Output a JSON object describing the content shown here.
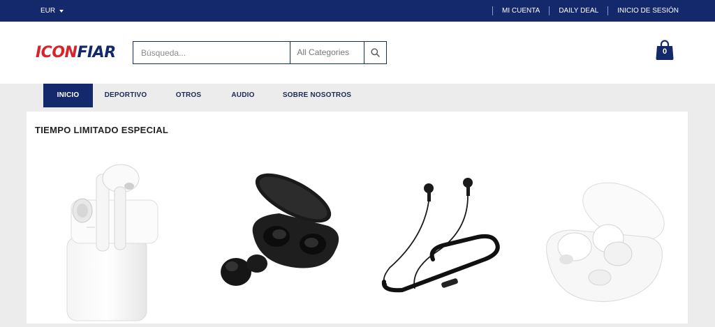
{
  "topbar": {
    "currency": "EUR",
    "links": [
      "MI CUENTA",
      "DAILY DEAL",
      "INICIO DE SESIÓN"
    ]
  },
  "header": {
    "logo_part1": "ICON",
    "logo_part2": "FIAR",
    "search_placeholder": "Búsqueda...",
    "category_selected": "All Categories",
    "cart_count": "0"
  },
  "nav": {
    "items": [
      "INICIO",
      "DEPORTIVO",
      "OTROS",
      "AUDIO",
      "SOBRE NOSOTROS"
    ],
    "active": "INICIO"
  },
  "section": {
    "title": "TIEMPO LIMITADO ESPECIAL"
  },
  "products": [
    {
      "image": "white-earbuds-in-charging-case"
    },
    {
      "image": "black-earbuds-in-open-case"
    },
    {
      "image": "black-neckband-earphones"
    },
    {
      "image": "white-earbuds-in-round-case"
    }
  ],
  "colors": {
    "brand_navy": "#14296b",
    "brand_red": "#d9232a",
    "background": "#ececec"
  }
}
